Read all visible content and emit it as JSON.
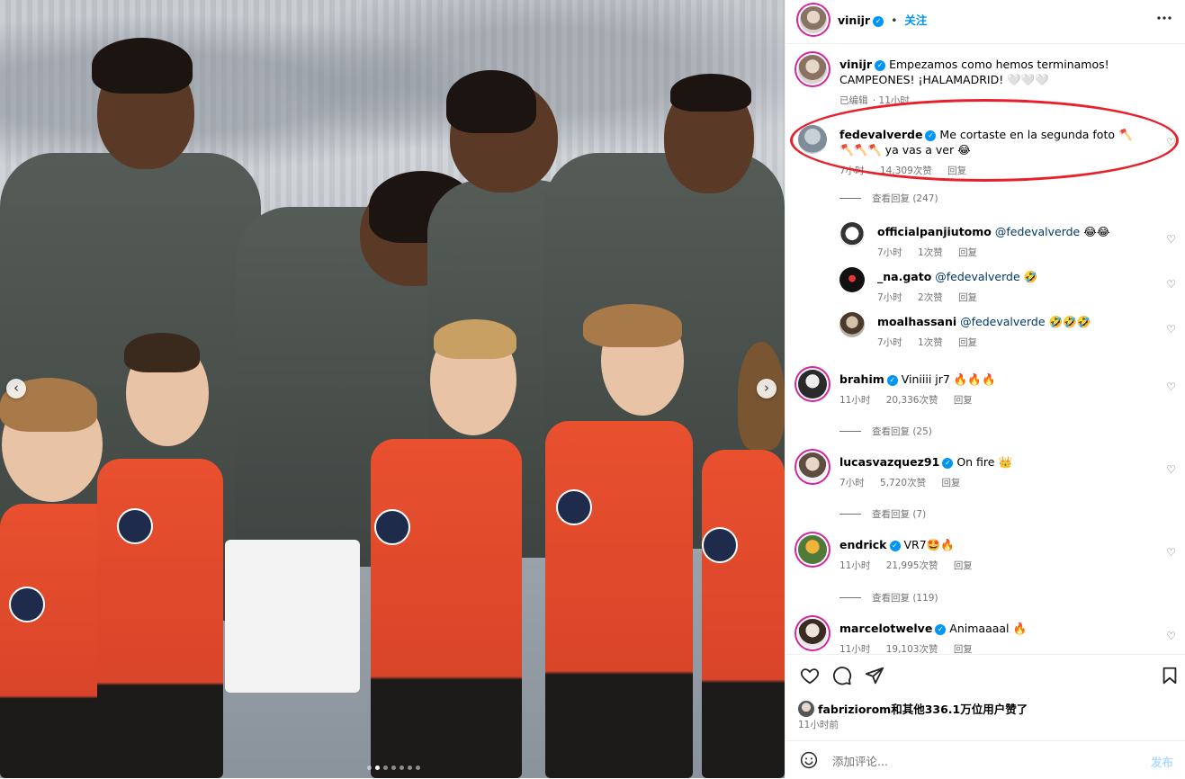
{
  "post_author": {
    "username": "vinijr",
    "follow_label": "关注",
    "separator": "•"
  },
  "caption": {
    "username": "vinijr",
    "text": "Empezamos como hemos terminamos! CAMPEONES! ¡HALAMADRID! 🤍🤍🤍",
    "edited": "已编辑",
    "time": "11小时"
  },
  "comments": [
    {
      "username": "fedevalverde",
      "verified": true,
      "text": "Me cortaste en la segunda foto 🪓🪓🪓🪓 ya vas a ver 😂",
      "time": "7小时",
      "likes": "14,309次赞",
      "reply_label": "回复",
      "view_replies": "查看回复 (247)",
      "replies": [
        {
          "username": "officialpanjiutomo",
          "mention": "@fedevalverde",
          "text": "😂😂",
          "time": "7小时",
          "likes": "1次赞",
          "reply_label": "回复"
        },
        {
          "username": "_na.gato",
          "mention": "@fedevalverde",
          "text": "🤣",
          "time": "7小时",
          "likes": "2次赞",
          "reply_label": "回复"
        },
        {
          "username": "moalhassani",
          "mention": "@fedevalverde",
          "text": "🤣🤣🤣",
          "time": "7小时",
          "likes": "1次赞",
          "reply_label": "回复"
        }
      ]
    },
    {
      "username": "brahim",
      "verified": true,
      "text": "Viniiii jr7 🔥🔥🔥",
      "time": "11小时",
      "likes": "20,336次赞",
      "reply_label": "回复",
      "view_replies": "查看回复 (25)"
    },
    {
      "username": "lucasvazquez91",
      "verified": true,
      "text": "On fire 👑",
      "time": "7小时",
      "likes": "5,720次赞",
      "reply_label": "回复",
      "view_replies": "查看回复 (7)"
    },
    {
      "username": "endrick",
      "verified": true,
      "text": "VR7🤩🔥",
      "time": "11小时",
      "likes": "21,995次赞",
      "reply_label": "回复",
      "view_replies": "查看回复 (119)"
    },
    {
      "username": "marcelotwelve",
      "verified": true,
      "text": "Animaaaal 🔥",
      "time": "11小时",
      "likes": "19,103次赞",
      "reply_label": "回复"
    }
  ],
  "actions": {
    "like_icon": "heart-icon",
    "comment_icon": "comment-icon",
    "share_icon": "share-icon",
    "save_icon": "bookmark-icon"
  },
  "likes_summary": {
    "text": "fabriziorom和其他336.1万位用户赞了"
  },
  "post_time": "11小时前",
  "add_comment": {
    "placeholder": "添加评论...",
    "post_label": "发布"
  },
  "colors": {
    "accent": "#0095f6",
    "highlight": "#e8202a"
  }
}
